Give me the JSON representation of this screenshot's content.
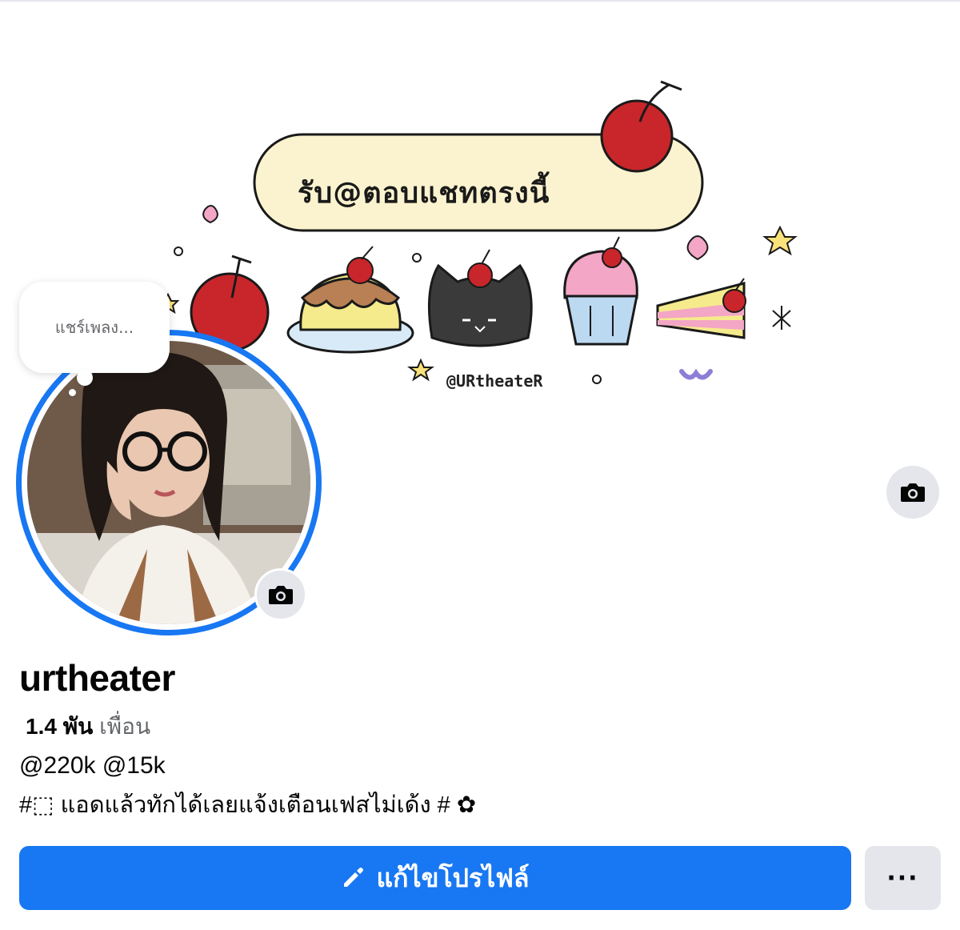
{
  "cover": {
    "banner_text": "รับ@ตอบแชทตรงนี้",
    "watermark": "@URtheateR"
  },
  "note": {
    "text": "แชร์เพลง..."
  },
  "profile": {
    "name": "urtheater",
    "friends_count": "1.4 พัน",
    "friends_label": "เพื่อน",
    "bio_line1": "@220k @15k",
    "bio_line2": "#⬚ แอดแล้วทักได้เลยแจ้งเตือนเฟสไม่เด้ง # ✿"
  },
  "actions": {
    "edit_profile_label": "แก้ไขโปรไฟล์",
    "more_label": "···"
  },
  "icons": {
    "cover_camera": "camera-icon",
    "avatar_camera": "camera-icon",
    "edit": "pencil-icon"
  },
  "colors": {
    "primary": "#1877f2",
    "secondary_button": "#e4e6eb",
    "text": "#050505",
    "muted_text": "#65676b"
  }
}
